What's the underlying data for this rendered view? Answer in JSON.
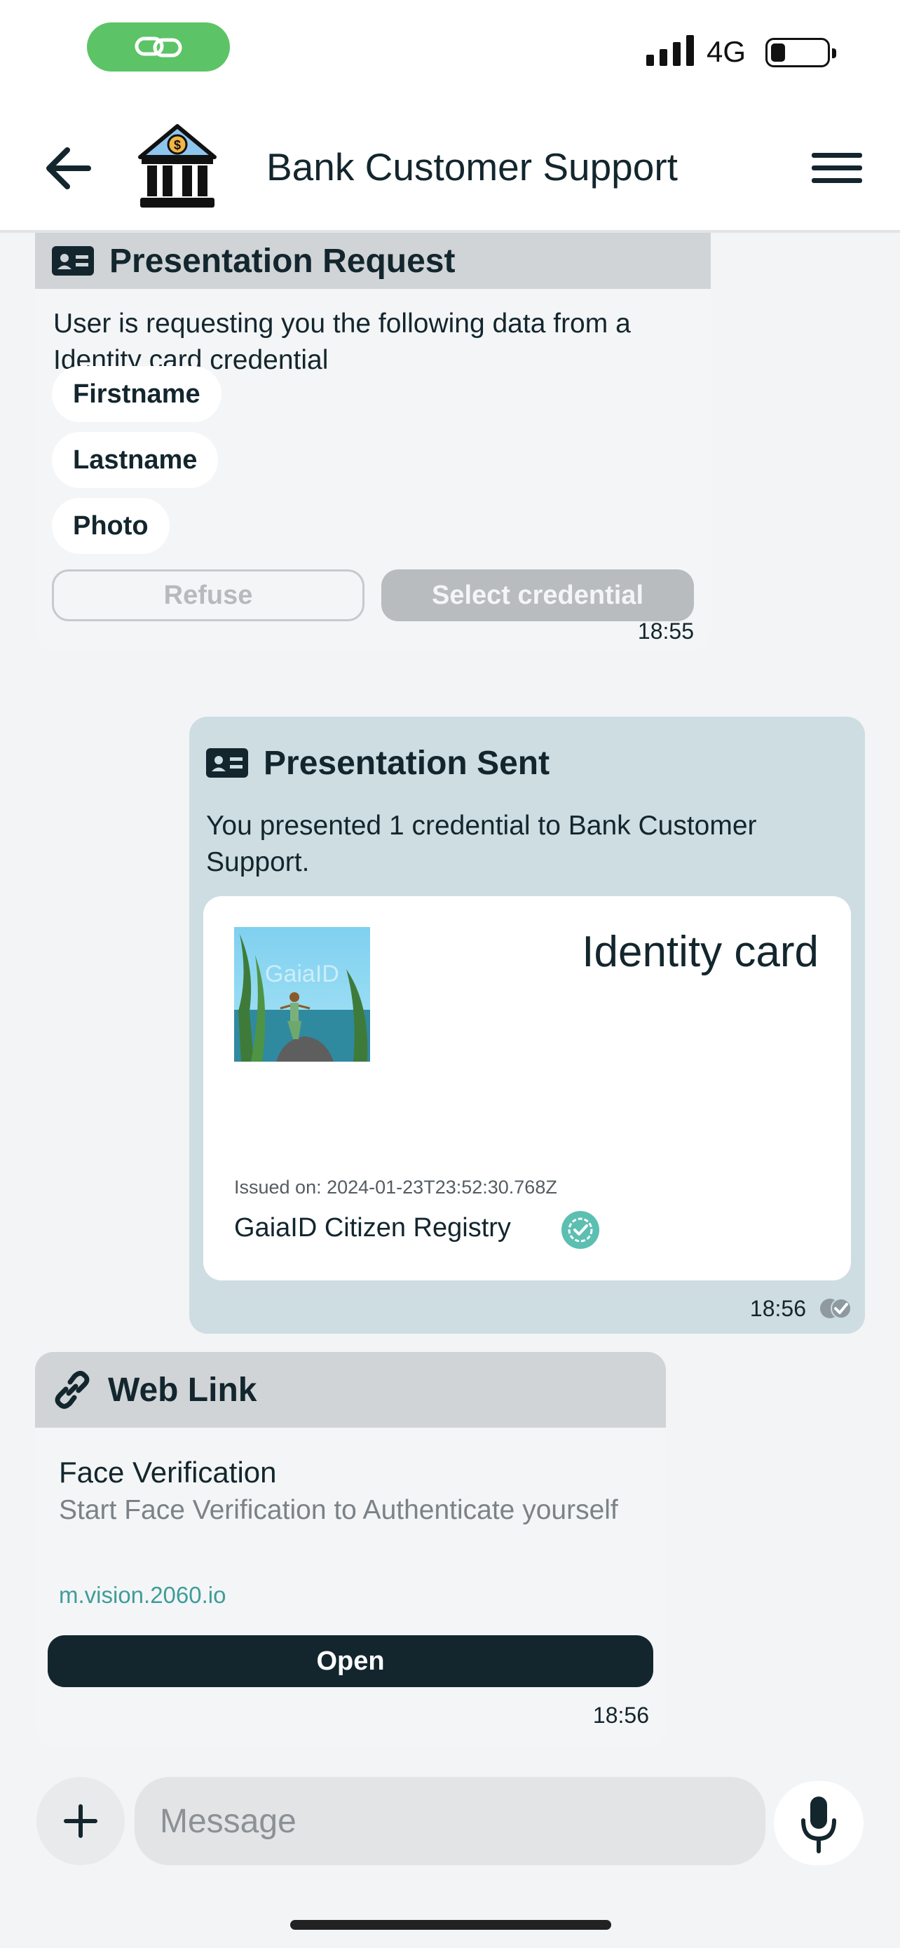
{
  "status_bar": {
    "network": "4G"
  },
  "header": {
    "title": "Bank Customer Support",
    "icons": {
      "back": "arrow-left-icon",
      "avatar": "bank-icon",
      "menu": "hamburger-menu-icon"
    }
  },
  "messages": {
    "presentation_request": {
      "title": "Presentation Request",
      "text": "User is requesting you the following data from a Identity card credential",
      "fields": [
        "Firstname",
        "Lastname",
        "Photo"
      ],
      "refuse_label": "Refuse",
      "select_label": "Select credential",
      "time": "18:55"
    },
    "presentation_sent": {
      "title": "Presentation Sent",
      "text": "You presented 1 credential to Bank Customer Support.",
      "credential": {
        "title": "Identity card",
        "issued": "Issued on: 2024-01-23T23:52:30.768Z",
        "issuer": "GaiaID Citizen Registry",
        "photo_watermark": "GaiaID"
      },
      "time": "18:56"
    },
    "web_link": {
      "title": "Web Link",
      "link_title": "Face Verification",
      "description": "Start Face Verification to Authenticate yourself",
      "url": "m.vision.2060.io",
      "open_label": "Open",
      "time": "18:56"
    }
  },
  "composer": {
    "placeholder": "Message"
  },
  "colors": {
    "accent_dark": "#13262e",
    "sent_bubble": "#cddde2",
    "received_bubble": "#f4f5f6",
    "card_header": "#d0d4d7",
    "link": "#3e9d9a",
    "status_pill": "#5cc466"
  }
}
